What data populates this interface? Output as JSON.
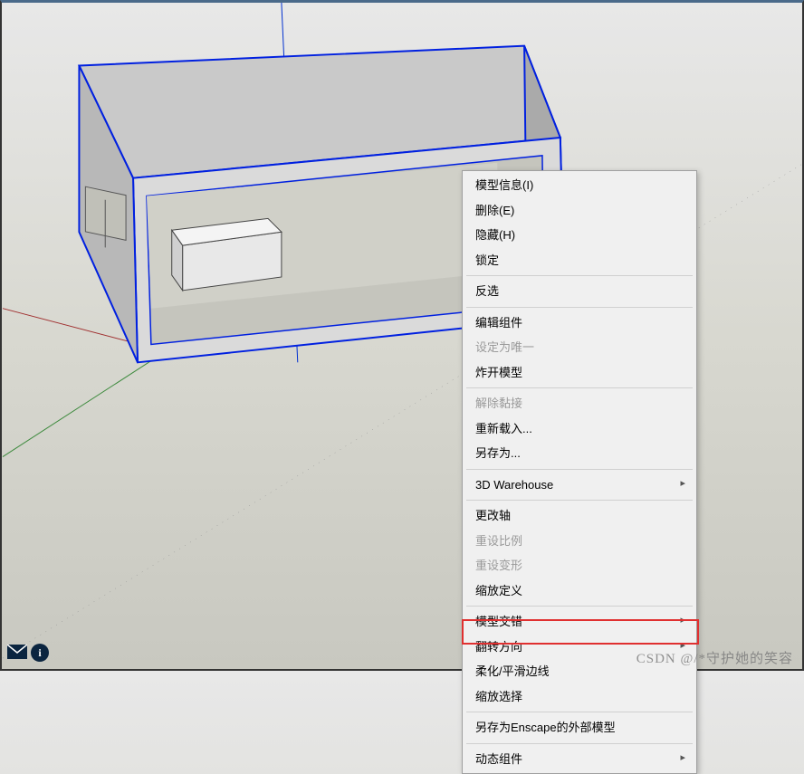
{
  "menu": {
    "model_info": "模型信息(I)",
    "delete": "删除(E)",
    "hide": "隐藏(H)",
    "lock": "锁定",
    "invert_selection": "反选",
    "edit_group": "编辑组件",
    "make_unique": "设定为唯一",
    "explode": "炸开模型",
    "unglue": "解除黏接",
    "reload": "重新载入...",
    "save_as": "另存为...",
    "warehouse": "3D Warehouse",
    "change_axes": "更改轴",
    "reset_scale": "重设比例",
    "reset_deform": "重设变形",
    "scale_definition": "缩放定义",
    "intersect": "模型交错",
    "flip": "翻转方向",
    "soften": "柔化/平滑边线",
    "zoom_selection": "缩放选择",
    "save_as_enscape": "另存为Enscape的外部模型",
    "dynamic_components": "动态组件"
  },
  "watermark": "CSDN @/*守护她的笑容"
}
